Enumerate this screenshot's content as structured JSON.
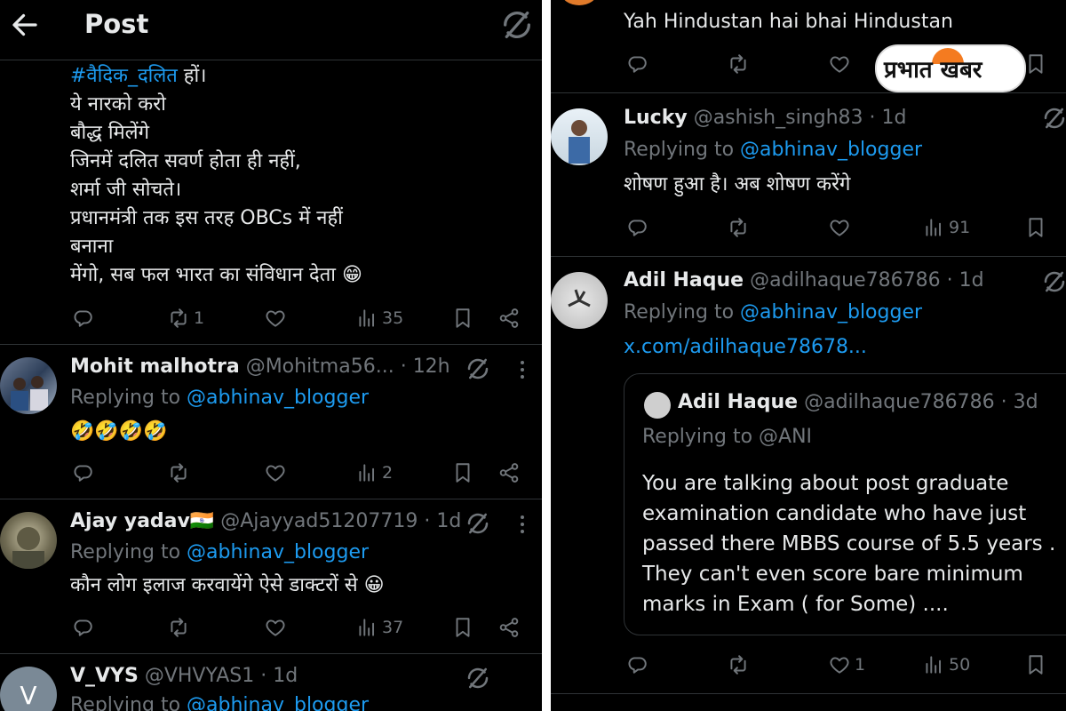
{
  "left": {
    "header": {
      "title": "Post"
    },
    "post_lines": [
      {
        "hashtag": "#वैदिक_दलित",
        "rest": " हों।"
      },
      {
        "text": "ये नारको करो"
      },
      {
        "text": "बौद्ध मिलेंगे"
      },
      {
        "text": "जिनमें दलित सवर्ण होता ही नहीं,"
      },
      {
        "text": "शर्मा जी सोचते।"
      },
      {
        "text": "प्रधानमंत्री तक इस तरह OBCs में नहीं"
      },
      {
        "text": "बनाना"
      },
      {
        "text": "मेंगो, सब फल भारत का संविधान देता 😁"
      }
    ],
    "post_actions": {
      "retweets": "1",
      "views": "35"
    },
    "replies": [
      {
        "name": "Mohit malhotra",
        "handle": "@Mohitma56...",
        "time": "· 12h",
        "replying_prefix": "Replying to ",
        "replying_to": "@abhinav_blogger",
        "text": "🤣🤣🤣🤣",
        "views": "2"
      },
      {
        "name": "Ajay yadav🇮🇳",
        "handle": "@Ajayyad51207719",
        "time": "· 1d",
        "replying_prefix": "Replying to ",
        "replying_to": "@abhinav_blogger",
        "text": "कौन लोग इलाज करवायेंगे ऐसे डाक्टरों से 😀",
        "views": "37"
      },
      {
        "name": "V_VYS",
        "handle": "@VHVYAS1",
        "time": "· 1d",
        "replying_prefix": "Replying to ",
        "replying_to": "@abhinav_blogger",
        "avatar_letter": "V"
      }
    ]
  },
  "right": {
    "top_text": "Yah Hindustan hai bhai Hindustan",
    "logo_text": "प्रभात खबर",
    "replies": [
      {
        "name": "Lucky",
        "handle": "@ashish_singh83",
        "time": "· 1d",
        "replying_prefix": "Replying to ",
        "replying_to": "@abhinav_blogger",
        "text": "शोषण हुआ है। अब शोषण करेंगे",
        "views": "91"
      },
      {
        "name": "Adil Haque",
        "handle": "@adilhaque786786",
        "time": "· 1d",
        "replying_prefix": "Replying to ",
        "replying_to": "@abhinav_blogger",
        "link": "x.com/adilhaque78678...",
        "likes": "1",
        "views": "50",
        "quote": {
          "name": "Adil Haque",
          "handle": "@adilhaque786786",
          "time": "· 3d",
          "replying": "Replying to @ANI",
          "lines": [
            "You are talking about post graduate",
            "examination candidate who have just",
            "passed there MBBS course of 5.5 years .",
            "They can't even score bare minimum",
            "marks in Exam ( for Some) ...."
          ]
        }
      }
    ]
  },
  "colors": {
    "background": "#000000",
    "text": "#e7e9ea",
    "muted": "#71767b",
    "link": "#1d9bf0",
    "divider": "#2f3336"
  }
}
